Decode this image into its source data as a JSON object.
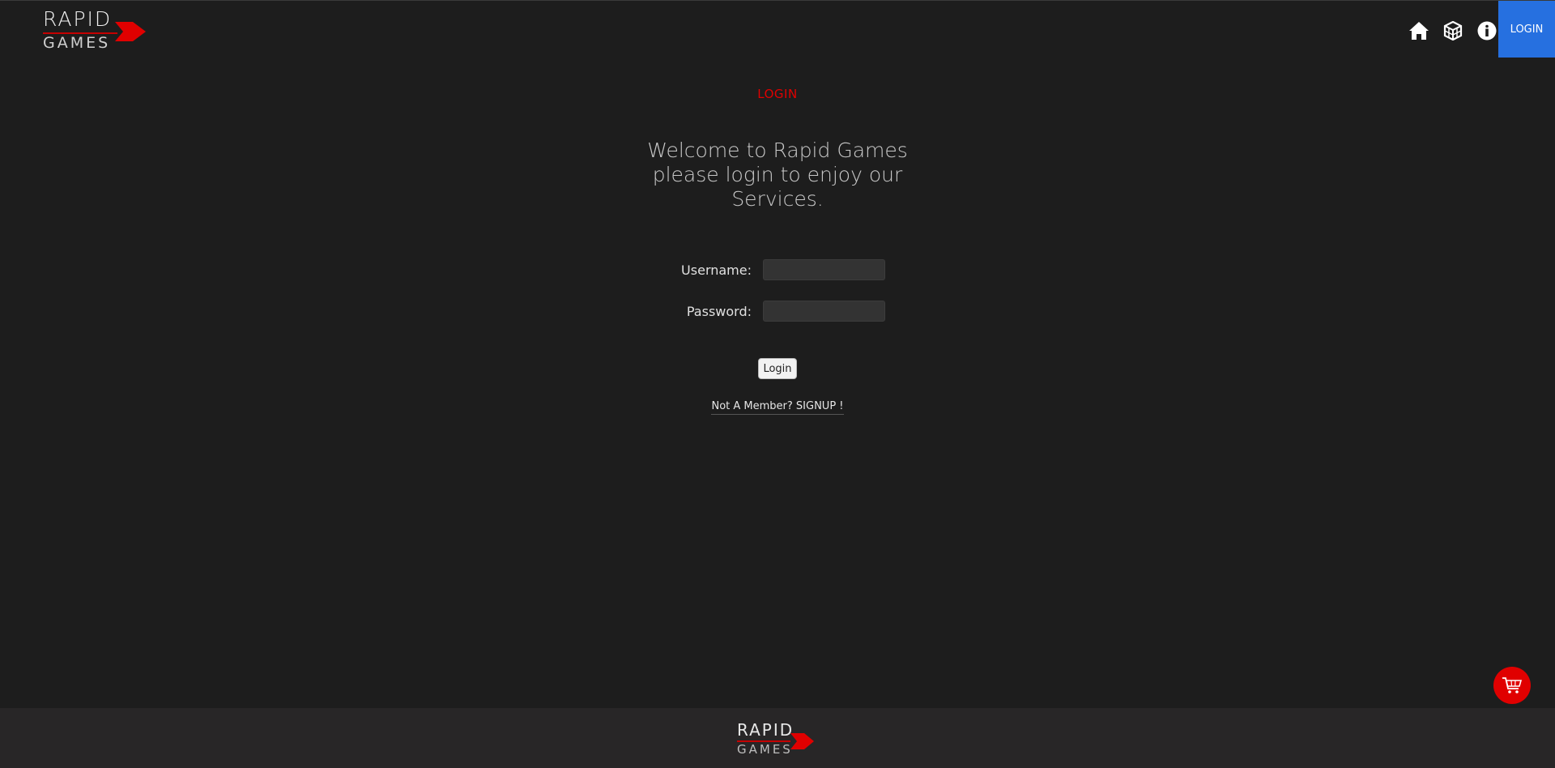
{
  "header": {
    "logo": {
      "top_text": "RAPID",
      "bottom_text": "GAMES"
    },
    "nav": {
      "icons": [
        "home-icon",
        "cube-icon",
        "info-icon"
      ],
      "login_label": "LOGIN"
    }
  },
  "main": {
    "section_title": "LOGIN",
    "welcome_line1": "Welcome to Rapid Games",
    "welcome_line2": "please login to enjoy our",
    "welcome_line3": "Services.",
    "form": {
      "username_label": "Username:",
      "username_value": "",
      "password_label": "Password:",
      "password_value": "",
      "submit_label": "Login"
    },
    "signup_text": "Not A Member? SIGNUP !"
  },
  "cart": {
    "icon": "cart-icon"
  },
  "footer": {
    "logo": {
      "top_text": "RAPID",
      "bottom_text": "GAMES"
    }
  },
  "colors": {
    "background": "#1d1d1d",
    "accent_red": "#e00000",
    "accent_blue": "#2670e0",
    "footer_bg": "#282627"
  }
}
